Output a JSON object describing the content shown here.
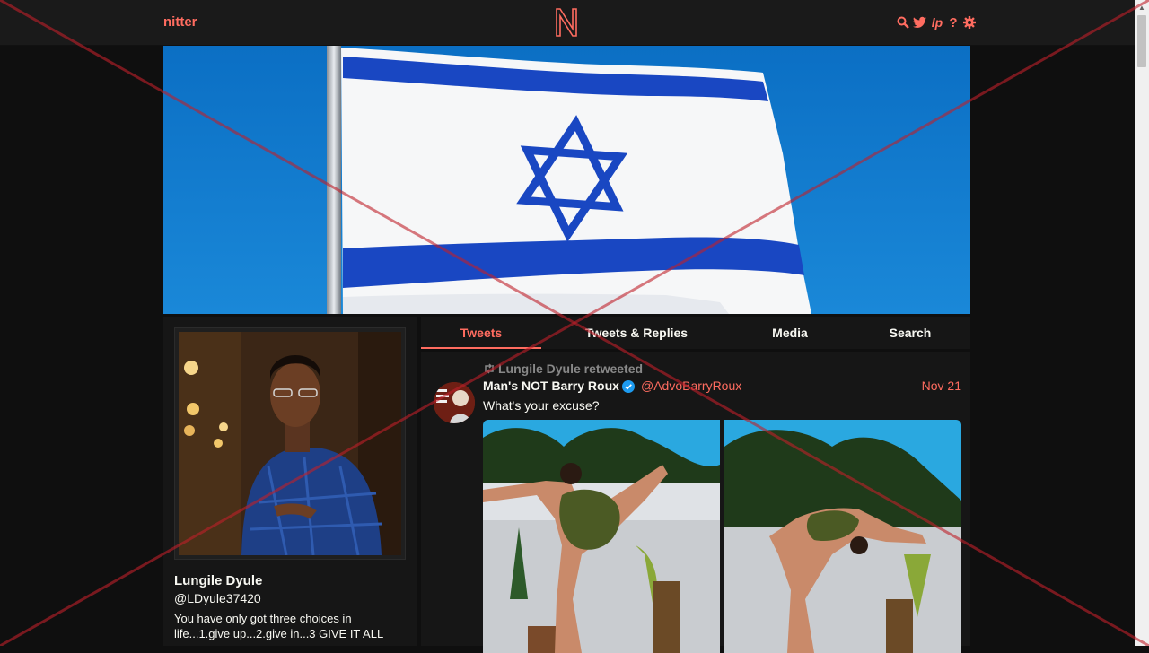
{
  "nav": {
    "brand": "nitter",
    "logo_letter": "N",
    "icons": [
      "search-icon",
      "twitter-bird-icon",
      "liberapay-icon",
      "help-icon",
      "settings-gear-icon"
    ],
    "help_glyph": "?",
    "liberapay_glyph": "lp"
  },
  "profile": {
    "fullname": "Lungile Dyule",
    "username": "@LDyule37420",
    "bio": "You have only got three choices in life...1.give up...2.give in...3 GIVE IT ALL"
  },
  "tabs": [
    {
      "label": "Tweets",
      "active": true
    },
    {
      "label": "Tweets & Replies",
      "active": false
    },
    {
      "label": "Media",
      "active": false
    },
    {
      "label": "Search",
      "active": false
    }
  ],
  "tweet": {
    "retweet_label": "Lungile Dyule retweeted",
    "fullname": "Man's NOT Barry Roux",
    "username": "@AdvoBarryRoux",
    "date": "Nov 21",
    "text": "What's your excuse?",
    "verified": true
  },
  "colors": {
    "accent": "#ff6c60",
    "background": "#0f0f0f",
    "panel": "#161616",
    "flag_blue": "#0038b8",
    "verified": "#1d9bf0"
  }
}
